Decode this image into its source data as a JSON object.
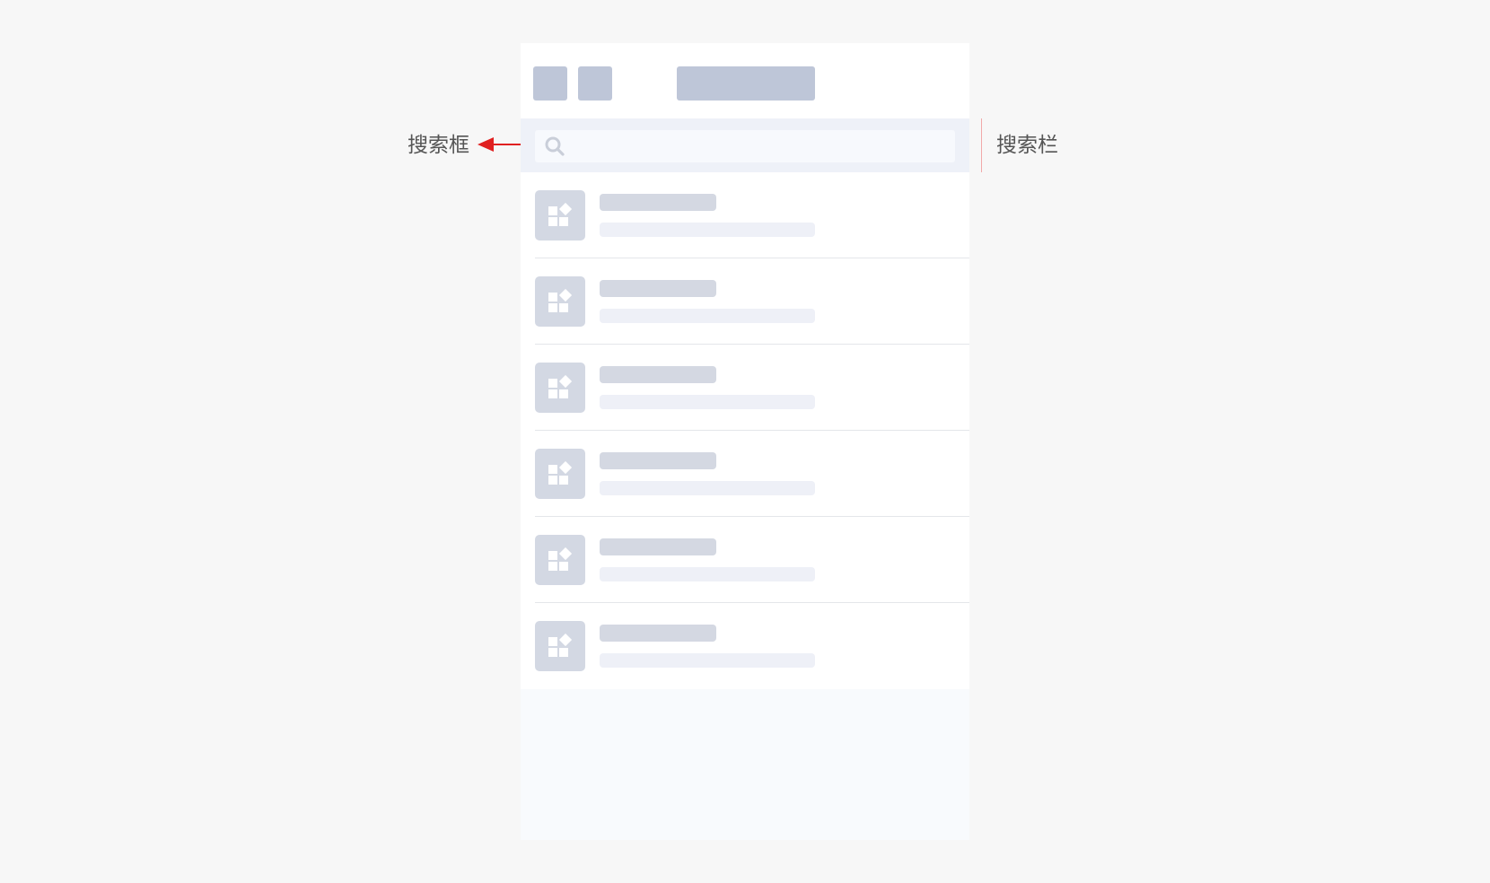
{
  "annotations": {
    "search_box_label": "搜索框",
    "search_bar_label": "搜索栏",
    "arrow_color": "#e02020",
    "bracket_color": "#f2a9a9"
  },
  "phone": {
    "header": {
      "nav_buttons": [
        "back-button-placeholder",
        "close-button-placeholder"
      ],
      "title_placeholder": true
    },
    "search": {
      "icon": "search-icon",
      "placeholder": ""
    },
    "list": {
      "item_icon": "apps-icon",
      "items": [
        {
          "title": "",
          "subtitle": ""
        },
        {
          "title": "",
          "subtitle": ""
        },
        {
          "title": "",
          "subtitle": ""
        },
        {
          "title": "",
          "subtitle": ""
        },
        {
          "title": "",
          "subtitle": ""
        },
        {
          "title": "",
          "subtitle": ""
        }
      ]
    }
  },
  "colors": {
    "page_bg": "#f7f7f7",
    "placeholder_dark": "#bec6d8",
    "placeholder_mid": "#d4d8e2",
    "placeholder_light": "#eef0f7",
    "search_bar_bg": "#eef1f8"
  }
}
